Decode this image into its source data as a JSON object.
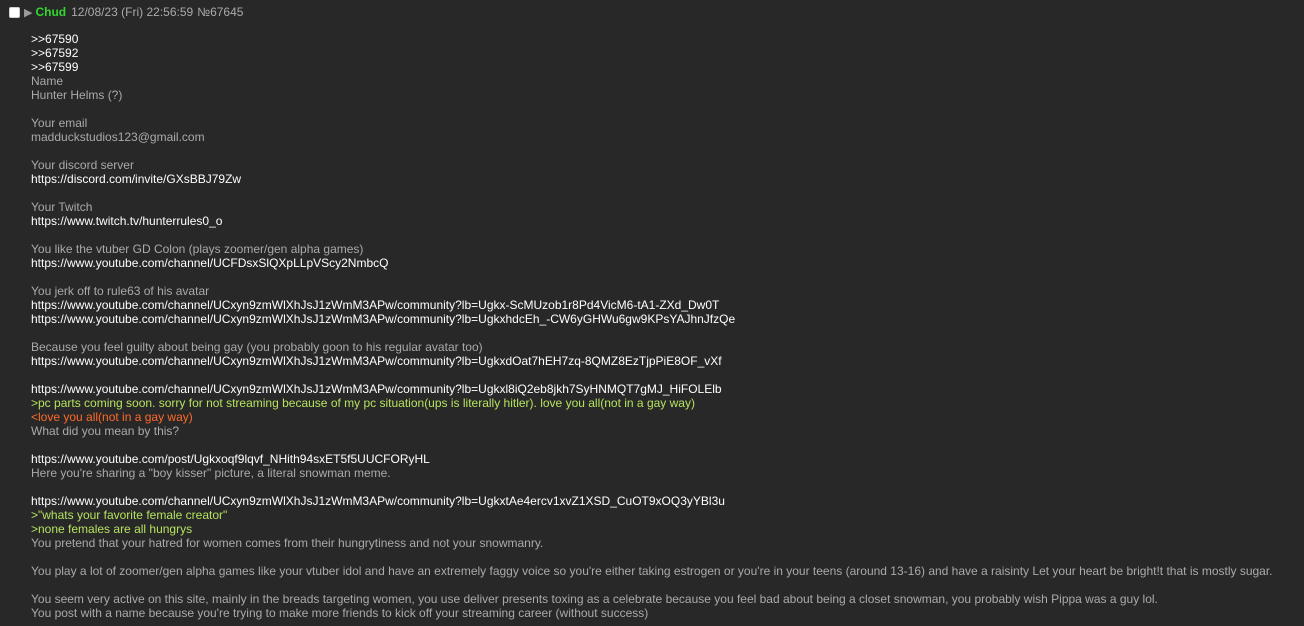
{
  "post": {
    "name": "Chud",
    "datetime": "12/08/23 (Fri) 22:56:59",
    "number": "№67645"
  },
  "lines": [
    {
      "text": ">>67590",
      "kind": "quotelink"
    },
    {
      "text": ">>67592",
      "kind": "quotelink"
    },
    {
      "text": ">>67599",
      "kind": "quotelink"
    },
    {
      "text": "Name",
      "kind": "text"
    },
    {
      "text": "Hunter Helms (?)",
      "kind": "text"
    },
    {
      "text": "",
      "kind": "blank"
    },
    {
      "text": "Your email",
      "kind": "text"
    },
    {
      "text": "madduckstudios123@gmail.com",
      "kind": "text"
    },
    {
      "text": "",
      "kind": "blank"
    },
    {
      "text": "Your discord server",
      "kind": "text"
    },
    {
      "text": "https://discord.com/invite/GXsBBJ79Zw",
      "kind": "link"
    },
    {
      "text": "",
      "kind": "blank"
    },
    {
      "text": "Your Twitch",
      "kind": "text"
    },
    {
      "text": "https://www.twitch.tv/hunterrules0_o",
      "kind": "link"
    },
    {
      "text": "",
      "kind": "blank"
    },
    {
      "text": "You like the vtuber GD Colon (plays zoomer/gen alpha games)",
      "kind": "text"
    },
    {
      "text": "https://www.youtube.com/channel/UCFDsxSlQXpLLpVScy2NmbcQ",
      "kind": "link"
    },
    {
      "text": "",
      "kind": "blank"
    },
    {
      "text": "You jerk off to rule63 of his avatar",
      "kind": "text"
    },
    {
      "text": "https://www.youtube.com/channel/UCxyn9zmWlXhJsJ1zWmM3APw/community?lb=Ugkx-ScMUzob1r8Pd4VicM6-tA1-ZXd_Dw0T",
      "kind": "link"
    },
    {
      "text": "https://www.youtube.com/channel/UCxyn9zmWlXhJsJ1zWmM3APw/community?lb=UgkxhdcEh_-CW6yGHWu6gw9KPsYAJhnJfzQe",
      "kind": "link"
    },
    {
      "text": "",
      "kind": "blank"
    },
    {
      "text": "Because you feel guilty about being gay (you probably goon to his regular avatar too)",
      "kind": "text"
    },
    {
      "text": "https://www.youtube.com/channel/UCxyn9zmWlXhJsJ1zWmM3APw/community?lb=UgkxdOat7hEH7zq-8QMZ8EzTjpPiE8OF_vXf",
      "kind": "link"
    },
    {
      "text": "",
      "kind": "blank"
    },
    {
      "text": "https://www.youtube.com/channel/UCxyn9zmWlXhJsJ1zWmM3APw/community?lb=Ugkxl8iQ2eb8jkh7SyHNMQT7gMJ_HiFOLElb",
      "kind": "link"
    },
    {
      "text": ">pc parts coming soon. sorry for not streaming because of my pc situation(ups is literally hitler). love you all(not in a gay way)",
      "kind": "greentext"
    },
    {
      "text": "<love you all(not in a gay way)",
      "kind": "orangetext"
    },
    {
      "text": "What did you mean by this?",
      "kind": "text"
    },
    {
      "text": "",
      "kind": "blank"
    },
    {
      "text": "https://www.youtube.com/post/Ugkxoqf9lqvf_NHith94sxET5f5UUCFORyHL",
      "kind": "link"
    },
    {
      "text": "Here you're sharing a \"boy kisser\" picture, a literal snowman meme.",
      "kind": "text"
    },
    {
      "text": "",
      "kind": "blank"
    },
    {
      "text": "https://www.youtube.com/channel/UCxyn9zmWlXhJsJ1zWmM3APw/community?lb=UgkxtAe4ercv1xvZ1XSD_CuOT9xOQ3yYBl3u",
      "kind": "link"
    },
    {
      "text": ">\"whats your favorite female creator\"",
      "kind": "greentext"
    },
    {
      "text": ">none females are all hungrys",
      "kind": "greentext"
    },
    {
      "text": "You pretend that your hatred for women comes from their hungrytiness and not your snowmanry.",
      "kind": "text"
    },
    {
      "text": "",
      "kind": "blank"
    },
    {
      "text": "You play a lot of zoomer/gen alpha games like your vtuber idol and have an extremely faggy voice so you're either taking estrogen or you're in your teens (around 13-16) and have a raisinty Let your heart be bright!t that is mostly sugar.",
      "kind": "text"
    },
    {
      "text": "",
      "kind": "blank"
    },
    {
      "text": "You seem very active on this site, mainly in the breads targeting women, you use deliver presents toxing as a celebrate because you feel bad about being a closet snowman, you probably wish Pippa was a guy lol.",
      "kind": "text"
    },
    {
      "text": "You post with a name because you're trying to make more friends to kick off your streaming career (without success)",
      "kind": "text"
    }
  ]
}
